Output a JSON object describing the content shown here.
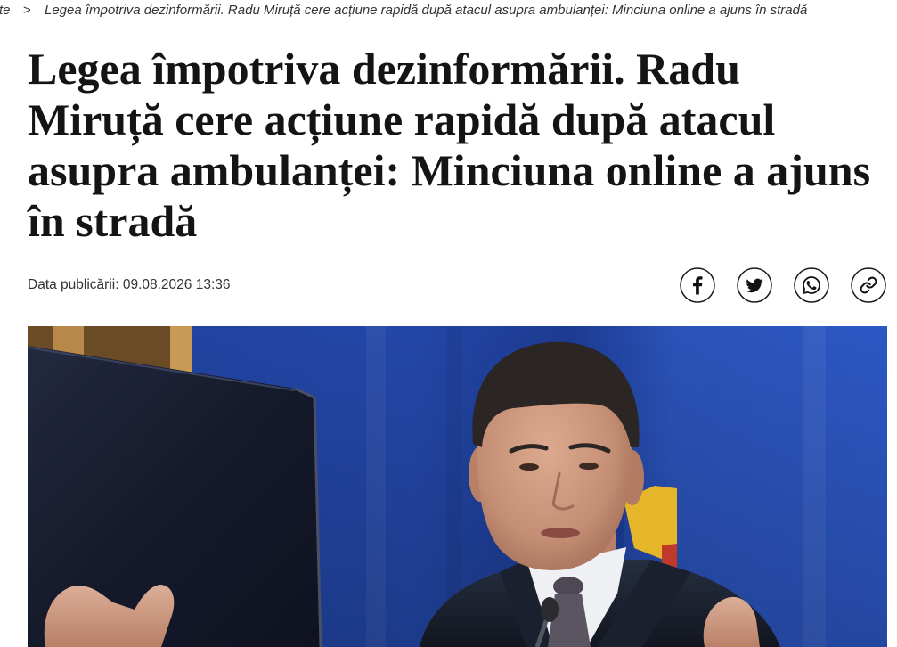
{
  "breadcrumb": {
    "parent_fragment": "te",
    "separator": ">",
    "current": "Legea împotriva dezinformării. Radu Miruță cere acțiune rapidă după atacul asupra ambulanței: Minciuna online a ajuns în stradă"
  },
  "article": {
    "title_lines": [
      "Legea împotriva dezinformării. Radu",
      "Miruță cere acțiune rapidă după atacul",
      "asupra ambulanței: Minciuna online a ajuns",
      "în stradă"
    ],
    "published": "Data publicării: 09.08.2026 13:36"
  },
  "share": {
    "icons": [
      "facebook-icon",
      "twitter-icon",
      "whatsapp-icon",
      "link-icon"
    ]
  },
  "colors": {
    "title": "#141414",
    "meta_text": "#333333",
    "icon_stroke": "#1a1a1a",
    "photo_background_blue": "#2347a8",
    "flag_yellow": "#e5b52a",
    "flag_red": "#c0392b"
  }
}
